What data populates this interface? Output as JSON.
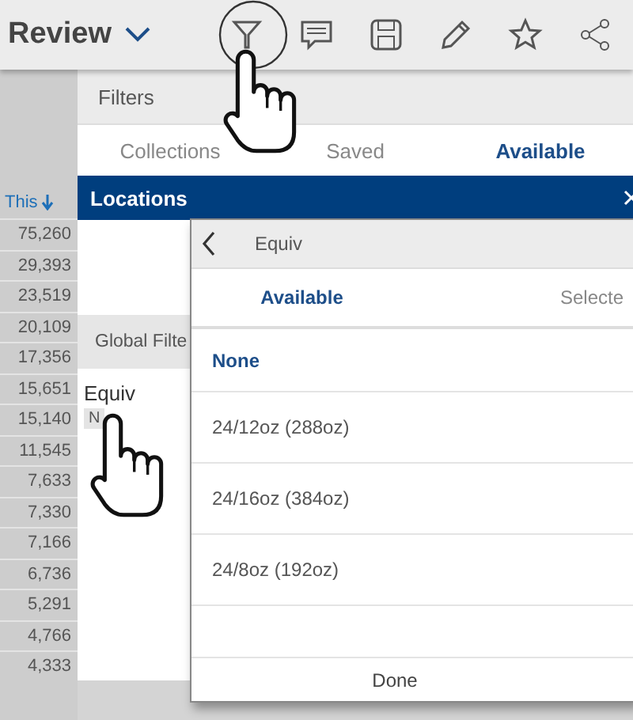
{
  "header": {
    "title": "Review"
  },
  "grid": {
    "column_header": "This",
    "values": [
      "75,260",
      "29,393",
      "23,519",
      "20,109",
      "17,356",
      "15,651",
      "15,140",
      "11,545",
      "7,633",
      "7,330",
      "7,166",
      "6,736",
      "5,291",
      "4,766",
      "4,333"
    ]
  },
  "filters": {
    "title": "Filters",
    "tabs": [
      {
        "label": "Collections",
        "selected": false
      },
      {
        "label": "Saved",
        "selected": false
      },
      {
        "label": "Available",
        "selected": true
      }
    ],
    "section": "Locations",
    "global_filters": "Global Filte",
    "field": {
      "label": "Equiv",
      "chip": "N"
    }
  },
  "popup": {
    "title": "Equiv",
    "tabs": [
      {
        "label": "Available",
        "selected": true
      },
      {
        "label": "Selecte",
        "selected": false
      }
    ],
    "options": [
      {
        "label": "None",
        "selected": true
      },
      {
        "label": "24/12oz (288oz)",
        "selected": false
      },
      {
        "label": "24/16oz (384oz)",
        "selected": false
      },
      {
        "label": "24/8oz (192oz)",
        "selected": false
      }
    ],
    "done": "Done"
  }
}
